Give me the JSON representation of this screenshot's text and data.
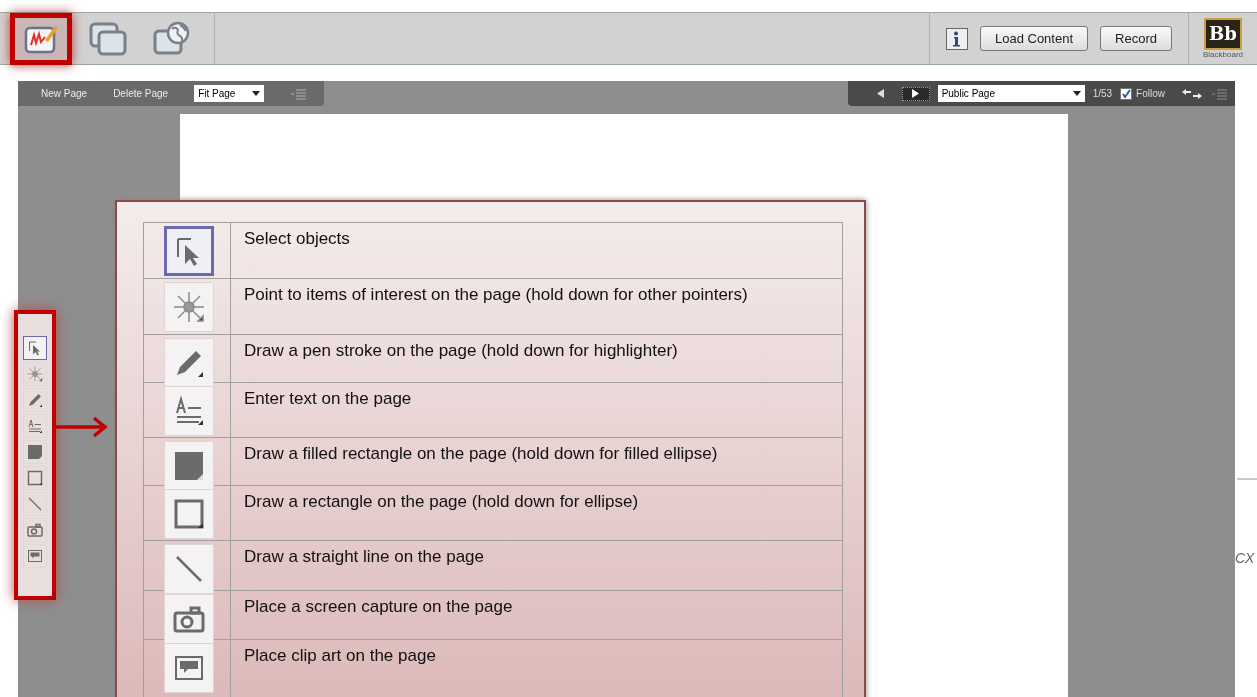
{
  "app_toolbar": {
    "modes": [
      {
        "kind": "whiteboard",
        "selected": true
      },
      {
        "kind": "windows",
        "selected": false
      },
      {
        "kind": "web",
        "selected": false
      }
    ],
    "buttons": [
      "Load Content",
      "Record"
    ],
    "logo": {
      "mark": "Bb",
      "caption": "Blackboard"
    }
  },
  "page_toolbar": {
    "items": [
      "New Page",
      "Delete Page"
    ],
    "zoom": "Fit Page"
  },
  "navigation": {
    "page_select": "Public Page",
    "page_count": "1/53",
    "follow": {
      "label": "Follow",
      "checked": true
    }
  },
  "palette": [
    {
      "kind": "select",
      "selected": true
    },
    {
      "kind": "pointer",
      "selected": false
    },
    {
      "kind": "pen",
      "selected": false
    },
    {
      "kind": "text",
      "selected": false
    },
    {
      "kind": "filled-rect",
      "selected": false
    },
    {
      "kind": "rect",
      "selected": false
    },
    {
      "kind": "line",
      "selected": false
    },
    {
      "kind": "camera",
      "selected": false
    },
    {
      "kind": "clipart",
      "selected": false
    }
  ],
  "legend": [
    {
      "kind": "select",
      "text": "Select objects",
      "selected": true
    },
    {
      "kind": "pointer",
      "text": "Point to items of interest on the page (hold down for other pointers)",
      "selected": false
    },
    {
      "kind": "pen",
      "text": "Draw a pen stroke on the page (hold down for highlighter)",
      "selected": false
    },
    {
      "kind": "text",
      "text": "Enter text on the page",
      "selected": false
    },
    {
      "kind": "filled-rect",
      "text": "Draw a filled rectangle on the page (hold down for filled ellipse)",
      "selected": false
    },
    {
      "kind": "rect",
      "text": "Draw a rectangle on the page (hold down for ellipse)",
      "selected": false
    },
    {
      "kind": "line",
      "text": "Draw a straight line on the page",
      "selected": false
    },
    {
      "kind": "camera",
      "text": "Place a screen capture on the page",
      "selected": false
    },
    {
      "kind": "clipart",
      "text": "Place clip art on the page",
      "selected": false
    }
  ],
  "side_text": "CX"
}
